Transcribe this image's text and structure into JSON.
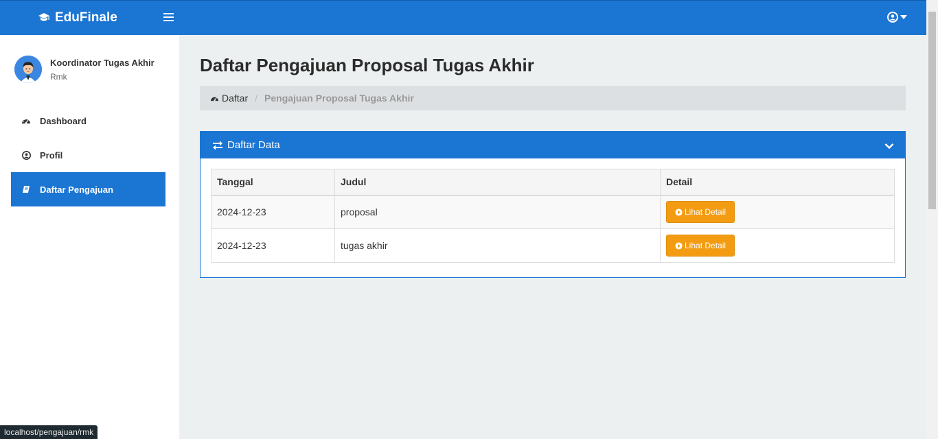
{
  "brand": {
    "name": "EduFinale"
  },
  "user": {
    "name": "Koordinator Tugas Akhir",
    "role": "Rmk"
  },
  "sidebar": {
    "items": [
      {
        "label": "Dashboard",
        "icon": "dashboard-icon"
      },
      {
        "label": "Profil",
        "icon": "user-circle-icon"
      },
      {
        "label": "Daftar Pengajuan",
        "icon": "book-icon",
        "active": true
      }
    ]
  },
  "page": {
    "title": "Daftar Pengajuan Proposal Tugas Akhir",
    "breadcrumb": {
      "home": "Daftar",
      "current": "Pengajuan Proposal Tugas Akhir"
    }
  },
  "panel": {
    "title": "Daftar Data"
  },
  "table": {
    "headers": [
      "Tanggal",
      "Judul",
      "Detail"
    ],
    "rows": [
      {
        "tanggal": "2024-12-23",
        "judul": "proposal",
        "action": "Lihat Detail"
      },
      {
        "tanggal": "2024-12-23",
        "judul": "tugas akhir",
        "action": "Lihat Detail"
      }
    ]
  },
  "status_url": "localhost/pengajuan/rmk",
  "colors": {
    "primary": "#1b75d3",
    "warning": "#f39c12",
    "background": "#ecf0f1"
  }
}
